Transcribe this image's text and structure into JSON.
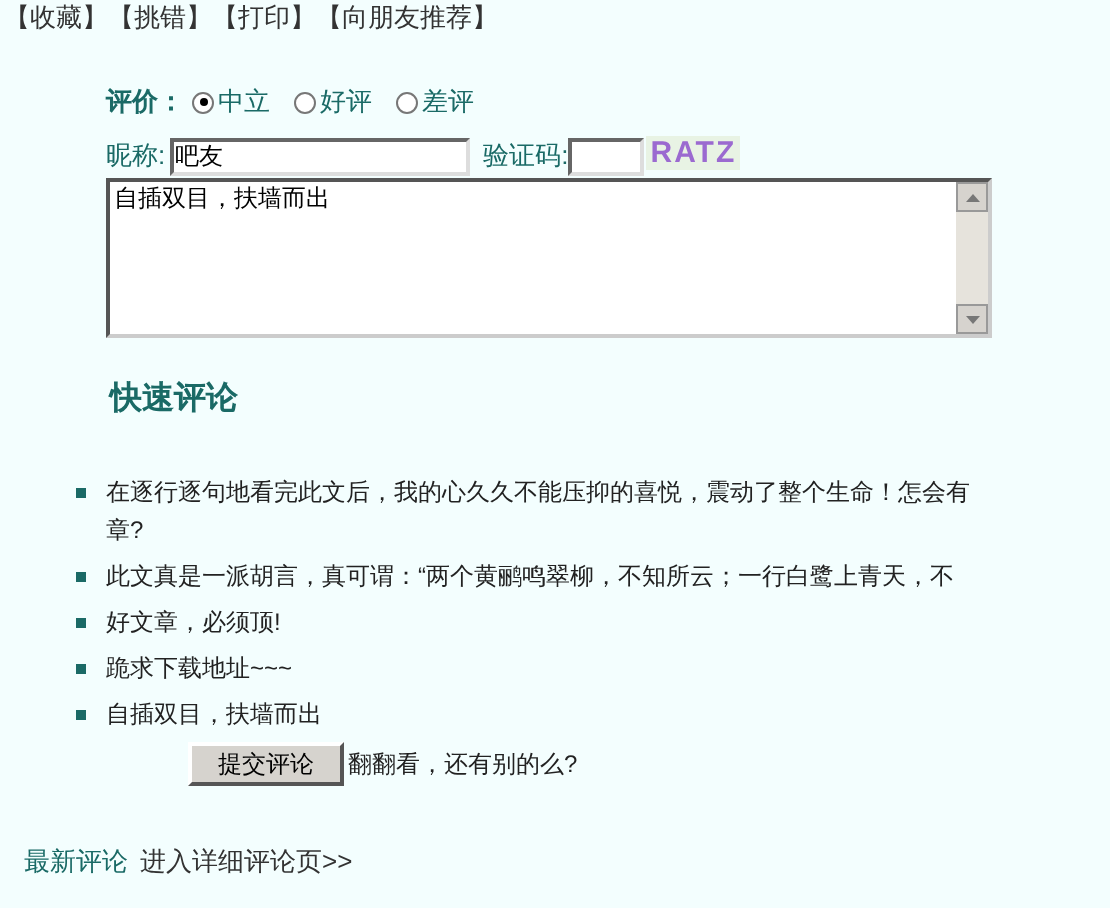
{
  "top_links": [
    "【收藏】",
    "【挑错】",
    "【打印】",
    "【向朋友推荐】"
  ],
  "rating": {
    "label": "评价：",
    "options": [
      {
        "label": "中立",
        "selected": true
      },
      {
        "label": "好评",
        "selected": false
      },
      {
        "label": "差评",
        "selected": false
      }
    ]
  },
  "nickname": {
    "label": "昵称:",
    "value": "吧友"
  },
  "captcha": {
    "label": "验证码:",
    "image_text": "RATZ"
  },
  "comment_box": {
    "value": "自插双目，扶墙而出"
  },
  "heading": "快速评论",
  "quick_comments": [
    {
      "lines": [
        "在逐行逐句地看完此文后，我的心久久不能压抑的喜悦，震动了整个生命！怎会有",
        "章?"
      ]
    },
    {
      "lines": [
        "此文真是一派胡言，真可谓：“两个黄鹂鸣翠柳，不知所云；一行白鹭上青天，不"
      ]
    },
    {
      "lines": [
        "好文章，必须顶!"
      ]
    },
    {
      "lines": [
        "跪求下载地址~~~"
      ]
    },
    {
      "lines": [
        "自插双目，扶墙而出"
      ]
    }
  ],
  "submit": {
    "label": "提交评论",
    "hint": "翻翻看，还有别的么?"
  },
  "footer": {
    "title": "最新评论",
    "link": "进入详细评论页>>"
  }
}
